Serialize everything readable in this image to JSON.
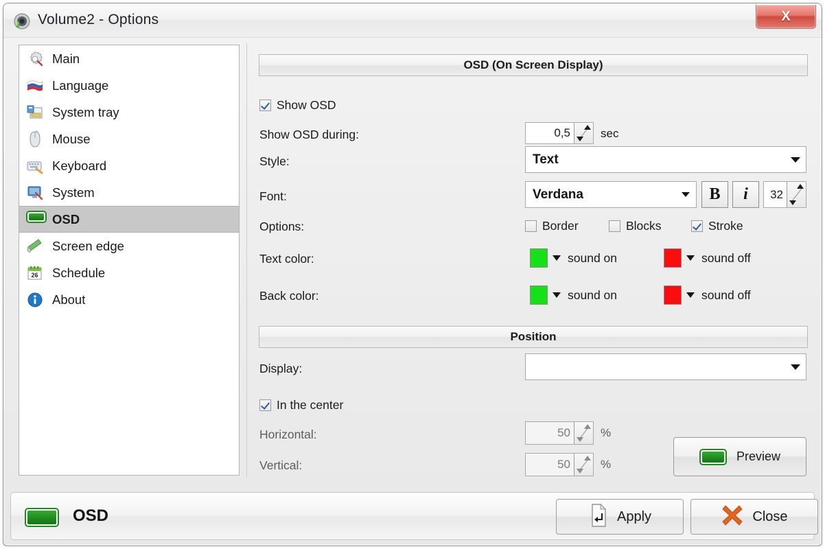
{
  "window": {
    "title": "Volume2 - Options",
    "title_icon": "volume-speaker-icon",
    "close_glyph": "X"
  },
  "sidebar": {
    "items": [
      {
        "label": "Main",
        "icon": "gear-icon",
        "selected": false
      },
      {
        "label": "Language",
        "icon": "flag-icon",
        "selected": false
      },
      {
        "label": "System tray",
        "icon": "system-tray-icon",
        "selected": false
      },
      {
        "label": "Mouse",
        "icon": "mouse-icon",
        "selected": false
      },
      {
        "label": "Keyboard",
        "icon": "keyboard-icon",
        "selected": false
      },
      {
        "label": "System",
        "icon": "monitor-icon",
        "selected": false
      },
      {
        "label": "OSD",
        "icon": "osd-icon",
        "selected": true
      },
      {
        "label": "Screen edge",
        "icon": "screen-edge-icon",
        "selected": false
      },
      {
        "label": "Schedule",
        "icon": "calendar-icon",
        "selected": false,
        "badge": "26"
      },
      {
        "label": "About",
        "icon": "info-icon",
        "selected": false
      }
    ]
  },
  "osd_section": {
    "header": "OSD (On Screen Display)",
    "show_osd": {
      "label": "Show OSD",
      "checked": true
    },
    "duration": {
      "label": "Show OSD during:",
      "value": "0,5",
      "unit": "sec"
    },
    "style": {
      "label": "Style:",
      "value": "Text"
    },
    "font": {
      "label": "Font:",
      "value": "Verdana",
      "bold_label": "B",
      "italic_label": "i",
      "size": "32"
    },
    "options": {
      "label": "Options:",
      "items": [
        {
          "label": "Border",
          "checked": false
        },
        {
          "label": "Blocks",
          "checked": false
        },
        {
          "label": "Stroke",
          "checked": true
        }
      ]
    },
    "text_color": {
      "label": "Text color:",
      "on": {
        "color": "#16E016",
        "label": "sound on"
      },
      "off": {
        "color": "#FB0D0D",
        "label": "sound off"
      }
    },
    "back_color": {
      "label": "Back color:",
      "on": {
        "color": "#16E016",
        "label": "sound on"
      },
      "off": {
        "color": "#FB0D0D",
        "label": "sound off"
      }
    }
  },
  "position_section": {
    "header": "Position",
    "display": {
      "label": "Display:",
      "value": ""
    },
    "in_center": {
      "label": "In the center",
      "checked": true
    },
    "horizontal": {
      "label": "Horizontal:",
      "value": "50",
      "unit": "%"
    },
    "vertical": {
      "label": "Vertical:",
      "value": "50",
      "unit": "%"
    },
    "preview": {
      "label": "Preview",
      "icon": "osd-green-icon"
    }
  },
  "bottom_bar": {
    "status": {
      "label": "OSD",
      "icon": "osd-green-icon"
    },
    "apply": {
      "label": "Apply",
      "icon": "enter-key-icon"
    },
    "close": {
      "label": "Close",
      "icon": "x-cross-icon"
    }
  }
}
